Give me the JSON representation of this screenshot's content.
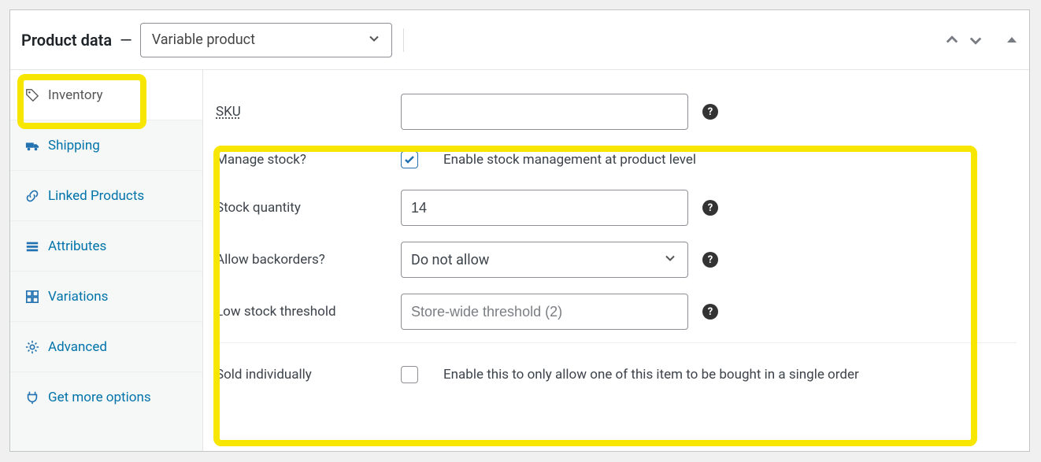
{
  "header": {
    "title": "Product data",
    "dash": "—",
    "product_type": "Variable product"
  },
  "tabs": {
    "inventory": "Inventory",
    "shipping": "Shipping",
    "linked_products": "Linked Products",
    "attributes": "Attributes",
    "variations": "Variations",
    "advanced": "Advanced",
    "get_more": "Get more options"
  },
  "form": {
    "sku": {
      "label": "SKU",
      "value": ""
    },
    "manage_stock": {
      "label": "Manage stock?",
      "checked": true,
      "desc": "Enable stock management at product level"
    },
    "stock_quantity": {
      "label": "Stock quantity",
      "value": "14"
    },
    "allow_backorders": {
      "label": "Allow backorders?",
      "value": "Do not allow"
    },
    "low_stock": {
      "label": "Low stock threshold",
      "placeholder": "Store-wide threshold (2)",
      "value": ""
    },
    "sold_individually": {
      "label": "Sold individually",
      "checked": false,
      "desc": "Enable this to only allow one of this item to be bought in a single order"
    }
  },
  "help_glyph": "?"
}
